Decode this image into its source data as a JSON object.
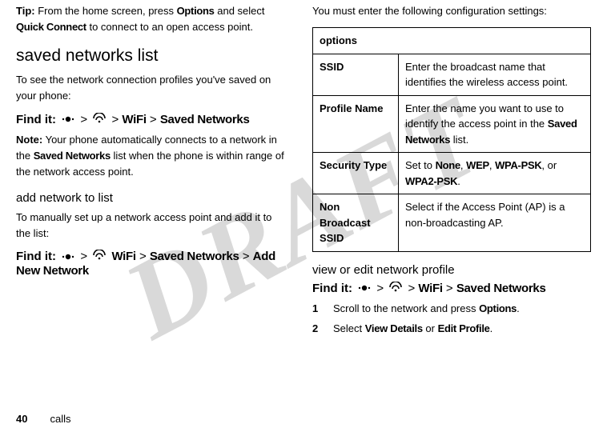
{
  "watermark": "DRAFT",
  "left": {
    "tip_label": "Tip:",
    "tip_text_1": " From the home screen, press ",
    "tip_opt": "Options",
    "tip_text_2": " and select ",
    "tip_qc": "Quick Connect",
    "tip_text_3": " to connect to an open access point.",
    "h2": "saved networks list",
    "p1": "To see the network connection profiles you've saved on your phone:",
    "findit_label": "Find it:",
    "fi1_wifi": "WiFi",
    "fi1_saved": "Saved Networks",
    "note_label": "Note:",
    "note_1": " Your phone automatically connects to a network in the ",
    "note_sn": "Saved Networks",
    "note_2": " list when the phone is within range of the network access point.",
    "h3": "add network to list",
    "p2": "To manually set up a network access point and add it to the list:",
    "fi2_wifi": "WiFi",
    "fi2_saved": "Saved Networks",
    "fi2_add": "Add New Network"
  },
  "right": {
    "intro": "You must enter the following configuration settings:",
    "table_header": "options",
    "rows": [
      {
        "k": "SSID",
        "v_pre": "Enter the broadcast name that identifies the wireless access point."
      },
      {
        "k": "Profile Name",
        "v_pre": "Enter the name you want to use to identify the access point in the ",
        "v_bold": "Saved Networks",
        "v_post": " list."
      },
      {
        "k": "Security Type",
        "v_pre": "Set to ",
        "opts": [
          "None",
          "WEP",
          "WPA-PSK",
          "WPA2-PSK"
        ]
      },
      {
        "k": "Non Broadcast SSID",
        "v_pre": "Select if the Access Point (AP) is a non-broadcasting AP."
      }
    ],
    "h3": "view or edit network profile",
    "findit_label": "Find it:",
    "fi_wifi": "WiFi",
    "fi_saved": "Saved Networks",
    "step1_n": "1",
    "step1_a": "Scroll to the network and press ",
    "step1_b": "Options",
    "step1_c": ".",
    "step2_n": "2",
    "step2_a": "Select ",
    "step2_b": "View Details",
    "step2_c": " or ",
    "step2_d": "Edit Profile",
    "step2_e": "."
  },
  "footer": {
    "page": "40",
    "section": "calls"
  }
}
